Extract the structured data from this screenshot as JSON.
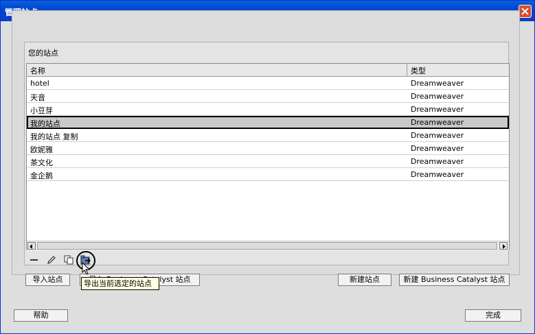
{
  "window": {
    "title": "管理站点"
  },
  "panel": {
    "title": "您的站点"
  },
  "table": {
    "headers": [
      "名称",
      "类型"
    ],
    "rows": [
      {
        "name": "hotel",
        "type": "Dreamweaver"
      },
      {
        "name": "天音",
        "type": "Dreamweaver"
      },
      {
        "name": "小豆芽",
        "type": "Dreamweaver"
      },
      {
        "name": "我的站点",
        "type": "Dreamweaver",
        "selected": true
      },
      {
        "name": "我的站点 复制",
        "type": "Dreamweaver"
      },
      {
        "name": "欧妮雅",
        "type": "Dreamweaver"
      },
      {
        "name": "茶文化",
        "type": "Dreamweaver"
      },
      {
        "name": "金企鹅",
        "type": "Dreamweaver"
      }
    ]
  },
  "toolbar": {
    "icons": [
      "remove-icon",
      "edit-icon",
      "duplicate-icon",
      "export-icon"
    ]
  },
  "tooltip": "导出当前选定的站点",
  "buttons": {
    "import_site": "导入站点",
    "import_bc": "导入 Business Catalyst 站点",
    "new_site": "新建站点",
    "new_bc": "新建 Business Catalyst 站点",
    "help": "帮助",
    "done": "完成"
  },
  "colors": {
    "titlebar": "#0046d5",
    "selected_row": "#c9c9c9",
    "tooltip_bg": "#ffffe1"
  }
}
